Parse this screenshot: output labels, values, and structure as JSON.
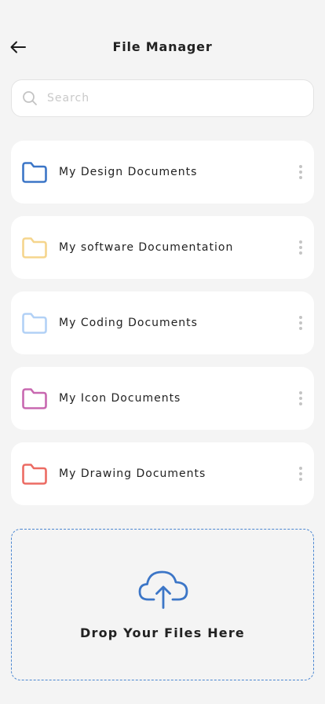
{
  "header": {
    "title": "File Manager",
    "back_icon": "arrow-left-icon"
  },
  "search": {
    "placeholder": "Search",
    "value": "",
    "icon": "search-icon"
  },
  "folders": [
    {
      "label": "My Design Documents",
      "color": "#3c76c7",
      "icon": "folder-icon"
    },
    {
      "label": "My software Documentation",
      "color": "#f5d58d",
      "icon": "folder-icon"
    },
    {
      "label": "My Coding Documents",
      "color": "#b2d1f6",
      "icon": "folder-icon"
    },
    {
      "label": "My Icon Documents",
      "color": "#c868b0",
      "icon": "folder-icon"
    },
    {
      "label": "My Drawing Documents",
      "color": "#ec6b63",
      "icon": "folder-icon"
    }
  ],
  "more_icon": "more-vertical-icon",
  "dropzone": {
    "label": "Drop Your Files Here",
    "icon": "cloud-upload-icon",
    "accent": "#3c76c7"
  }
}
